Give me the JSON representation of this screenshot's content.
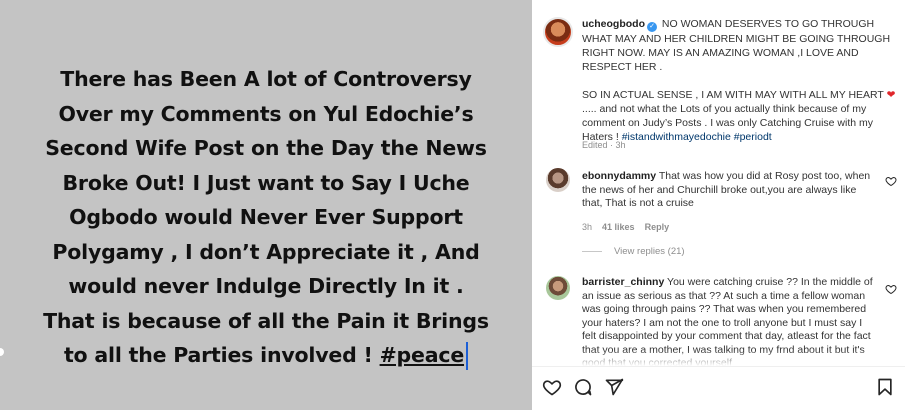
{
  "post": {
    "lines": [
      "There has Been A lot of Controversy",
      "Over my Comments on Yul Edochie’s",
      "Second Wife Post on the Day the News",
      "Broke Out! I Just want to Say I Uche",
      "Ogbodo would Never Ever Support",
      "Polygamy , I don’t Appreciate it , And",
      "would never Indulge Directly In it .",
      "That is because of all the Pain it Brings"
    ],
    "last_line_text": "to all the Parties involved ! ",
    "last_line_tag": "#peace"
  },
  "caption": {
    "username": "ucheogbodo",
    "verified_mark": "✓",
    "para1": "NO WOMAN DESERVES TO GO THROUGH WHAT MAY AND HER CHILDREN MIGHT BE GOING THROUGH RIGHT NOW. MAY IS AN AMAZING WOMAN ,I LOVE AND RESPECT HER .",
    "para2": "SO IN ACTUAL SENSE , I AM WITH MAY WITH ALL MY HEART",
    "heart": "❤",
    "para3": "..... and not what the Lots of you actually think because of my comment on Judy’s Posts . I was only Catching Cruise with my Haters ! ",
    "hashtags": "#istandwithmayedochie #periodt",
    "meta": "Edited · 3h"
  },
  "comments": [
    {
      "username": "ebonnydammy",
      "text": "That was how you did at Rosy post too, when the news of her and Churchill broke out,you are always like that, That is not a cruise",
      "time": "3h",
      "likes": "41 likes",
      "reply": "Reply",
      "avatar_color": "#9a7b68",
      "view_replies": "View replies (21)"
    },
    {
      "username": "barrister_chinny",
      "text": "You were catching cruise ?? In the middle of an issue as serious as that ?? At such a time a fellow woman was going through pains ?? That was when you remembered your haters? I am not the one to troll anyone but I must say I felt disappointed by your comment that day, atleast for the fact that you are a mother, I was talking to my frnd about it but it's good that you corrected yourself",
      "avatar_color": "#b6c9a4"
    }
  ],
  "actions": {
    "like": "heart-icon",
    "comment": "comment-icon",
    "share": "share-icon",
    "save": "bookmark-icon"
  }
}
